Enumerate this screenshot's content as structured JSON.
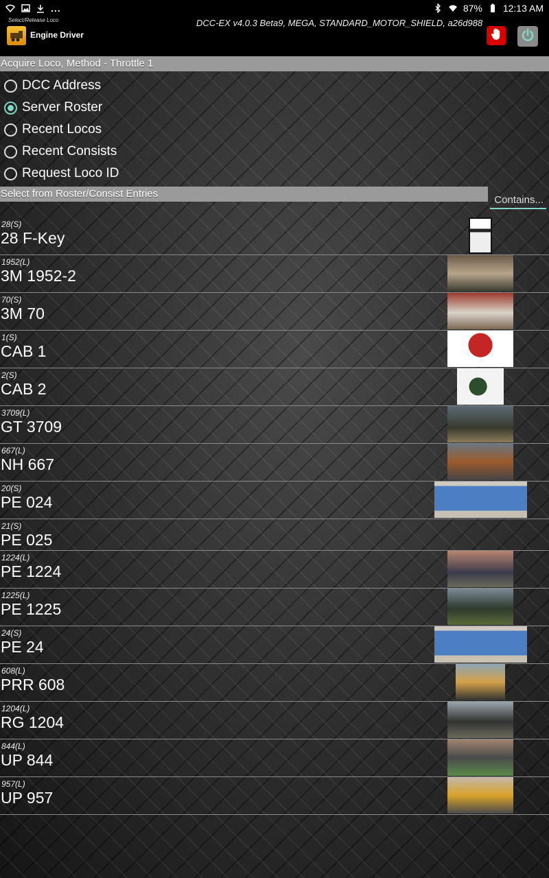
{
  "status_bar": {
    "left_icons": [
      "wifi-icon",
      "image-icon",
      "download-icon"
    ],
    "overflow": "...",
    "battery": "87%",
    "time": "12:13 AM"
  },
  "app_bar": {
    "subtitle": "Select/Release Loco",
    "title": "Engine Driver",
    "server_info": "DCC-EX v4.0.3 Beta9, MEGA, STANDARD_MOTOR_SHIELD, a26d988",
    "stop_icon": "hand-stop-icon",
    "power_icon": "power-icon",
    "stop_color": "#d80000",
    "power_color": "#7fd9c4"
  },
  "acquire": {
    "header": "Acquire Loco, Method - Throttle 1",
    "options": [
      {
        "label": "DCC Address",
        "checked": false
      },
      {
        "label": "Server Roster",
        "checked": true
      },
      {
        "label": "Recent Locos",
        "checked": false
      },
      {
        "label": "Recent Consists",
        "checked": false
      },
      {
        "label": "Request Loco ID",
        "checked": false
      }
    ]
  },
  "roster": {
    "header": "Select from Roster/Consist Entries",
    "filter_placeholder": "Contains...",
    "entries": [
      {
        "address": "28(S)",
        "name": "28 F-Key"
      },
      {
        "address": "1952(L)",
        "name": "3M 1952-2"
      },
      {
        "address": "70(S)",
        "name": "3M 70"
      },
      {
        "address": "1(S)",
        "name": "CAB 1"
      },
      {
        "address": "2(S)",
        "name": "CAB 2"
      },
      {
        "address": "3709(L)",
        "name": "GT 3709"
      },
      {
        "address": "667(L)",
        "name": "NH 667"
      },
      {
        "address": "20(S)",
        "name": "PE 024"
      },
      {
        "address": "21(S)",
        "name": "PE 025"
      },
      {
        "address": "1224(L)",
        "name": "PE 1224"
      },
      {
        "address": "1225(L)",
        "name": "PE 1225"
      },
      {
        "address": "24(S)",
        "name": "PE 24"
      },
      {
        "address": "608(L)",
        "name": "PRR 608"
      },
      {
        "address": "1204(L)",
        "name": "RG 1204"
      },
      {
        "address": "844(L)",
        "name": "UP 844"
      },
      {
        "address": "957(L)",
        "name": "UP 957"
      }
    ]
  }
}
